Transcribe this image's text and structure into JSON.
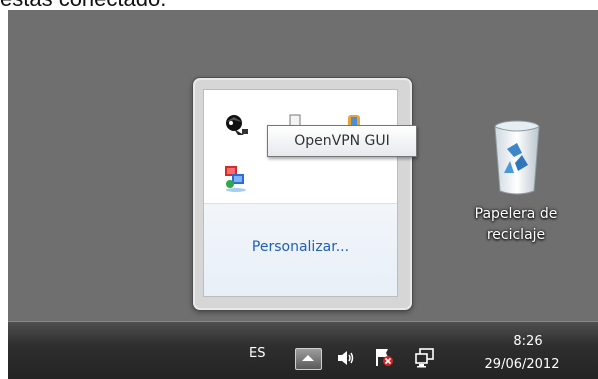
{
  "caption": "estás conectado.",
  "tooltip": {
    "text": "OpenVPN GUI"
  },
  "flyout": {
    "customize_link": "Personalizar...",
    "icons": [
      "openvpn-icon",
      "generic-app-icon",
      "shield-app-icon",
      "network-app-icon"
    ]
  },
  "desktop": {
    "recycle_bin_line1": "Papelera de",
    "recycle_bin_line2": "reciclaje"
  },
  "taskbar": {
    "language": "ES",
    "clock_time": "8:26",
    "clock_date": "29/06/2012",
    "icons": [
      "show-hidden-icons-icon",
      "speaker-icon",
      "action-center-flag-icon",
      "network-icon"
    ]
  }
}
